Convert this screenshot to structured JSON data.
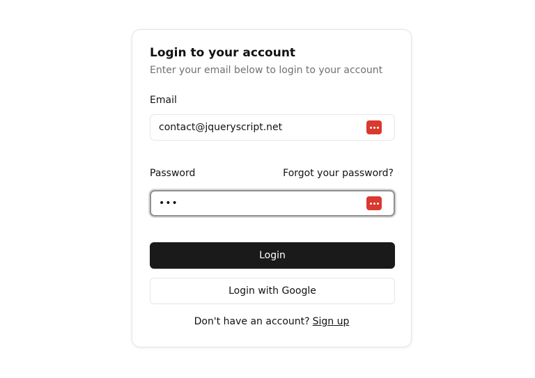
{
  "card": {
    "title": "Login to your account",
    "subtitle": "Enter your email below to login to your account"
  },
  "email": {
    "label": "Email",
    "value": "contact@jqueryscript.net",
    "icon": "password-manager-icon"
  },
  "password": {
    "label": "Password",
    "value": "•••",
    "forgot_label": "Forgot your password?",
    "icon": "password-manager-icon"
  },
  "actions": {
    "login_label": "Login",
    "google_label": "Login with Google"
  },
  "signup": {
    "prompt": "Don't have an account?",
    "link_label": "Sign up"
  },
  "colors": {
    "primary_button": "#1a1a1a",
    "password_manager_icon": "#d9392f",
    "muted_text": "#707070"
  }
}
